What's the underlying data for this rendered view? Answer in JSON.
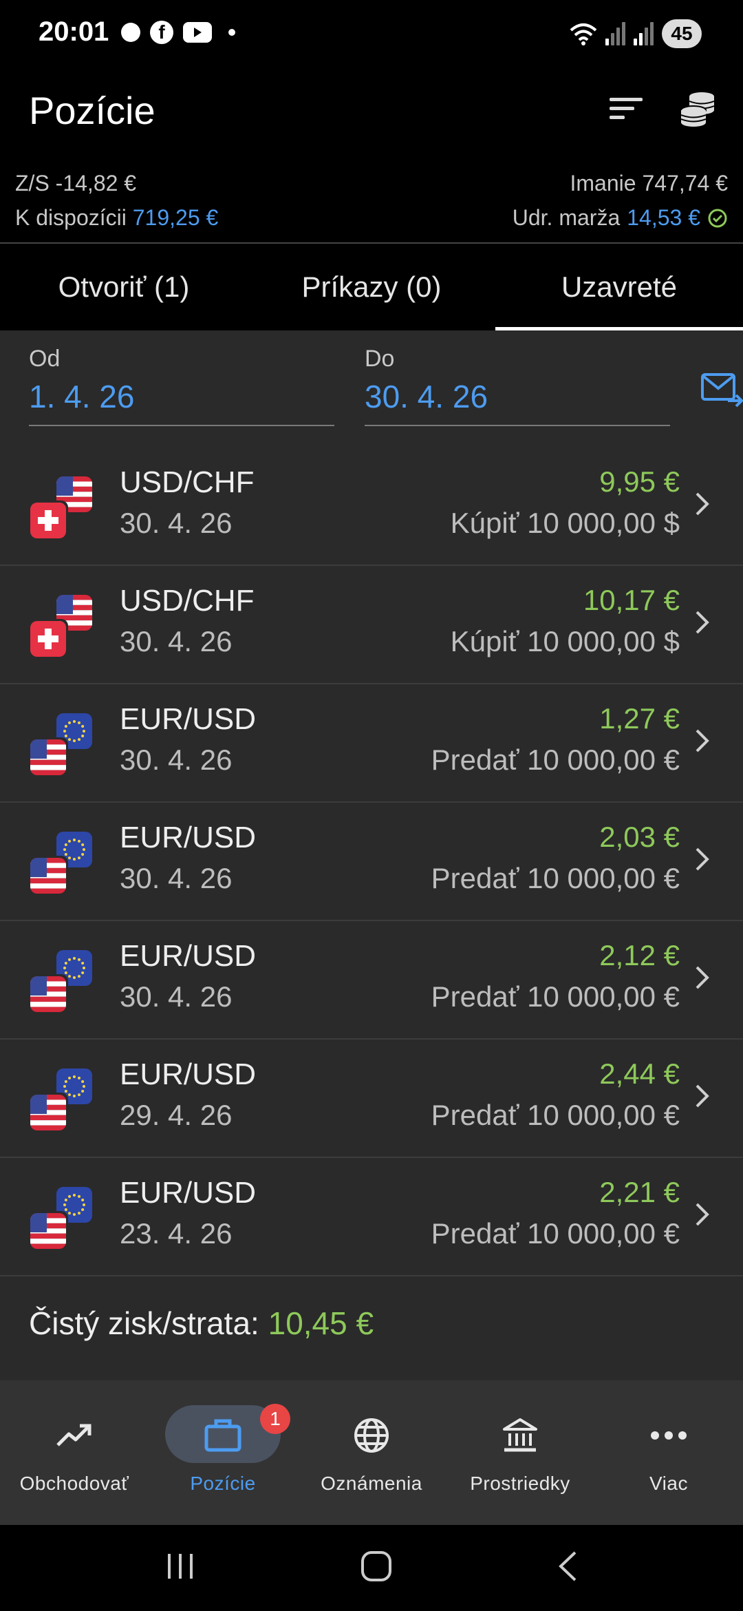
{
  "status_bar": {
    "time": "20:01",
    "battery": "45"
  },
  "header": {
    "title": "Pozície"
  },
  "summary": {
    "zs": "Z/S -14,82 €",
    "k_label": "K dispozícii",
    "k_value": "719,25 €",
    "imanie": "Imanie 747,74 €",
    "marza_label": "Udr. marža",
    "marza_value": "14,53 €"
  },
  "tabs": [
    {
      "label": "Otvoriť (1)"
    },
    {
      "label": "Príkazy (0)"
    },
    {
      "label": "Uzavreté",
      "active": true
    }
  ],
  "filters": {
    "od_label": "Od",
    "od_value": "1. 4. 26",
    "do_label": "Do",
    "do_value": "30. 4. 26"
  },
  "trades": [
    {
      "symbol": "USD/CHF",
      "date": "30. 4. 26",
      "pl": "9,95 €",
      "side": "Kúpiť 10 000,00 $",
      "flags": [
        "usa",
        "chf"
      ]
    },
    {
      "symbol": "USD/CHF",
      "date": "30. 4. 26",
      "pl": "10,17 €",
      "side": "Kúpiť 10 000,00 $",
      "flags": [
        "usa",
        "chf"
      ]
    },
    {
      "symbol": "EUR/USD",
      "date": "30. 4. 26",
      "pl": "1,27 €",
      "side": "Predať 10 000,00 €",
      "flags": [
        "eu",
        "usa"
      ]
    },
    {
      "symbol": "EUR/USD",
      "date": "30. 4. 26",
      "pl": "2,03 €",
      "side": "Predať 10 000,00 €",
      "flags": [
        "eu",
        "usa"
      ]
    },
    {
      "symbol": "EUR/USD",
      "date": "30. 4. 26",
      "pl": "2,12 €",
      "side": "Predať 10 000,00 €",
      "flags": [
        "eu",
        "usa"
      ]
    },
    {
      "symbol": "EUR/USD",
      "date": "29. 4. 26",
      "pl": "2,44 €",
      "side": "Predať 10 000,00 €",
      "flags": [
        "eu",
        "usa"
      ]
    },
    {
      "symbol": "EUR/USD",
      "date": "23. 4. 26",
      "pl": "2,21 €",
      "side": "Predať 10 000,00 €",
      "flags": [
        "eu",
        "usa"
      ]
    }
  ],
  "total": {
    "label": "Čistý zisk/strata:",
    "value": "10,45 €"
  },
  "bottom_nav": [
    {
      "label": "Obchodovať",
      "icon": "trending-up-icon"
    },
    {
      "label": "Pozície",
      "icon": "briefcase-icon",
      "active": true,
      "badge": "1"
    },
    {
      "label": "Oznámenia",
      "icon": "globe-icon"
    },
    {
      "label": "Prostriedky",
      "icon": "bank-icon"
    },
    {
      "label": "Viac",
      "icon": "more-icon"
    }
  ],
  "colors": {
    "accent": "#4d9cf0",
    "profit": "#8ec95a",
    "badge": "#e84545"
  }
}
